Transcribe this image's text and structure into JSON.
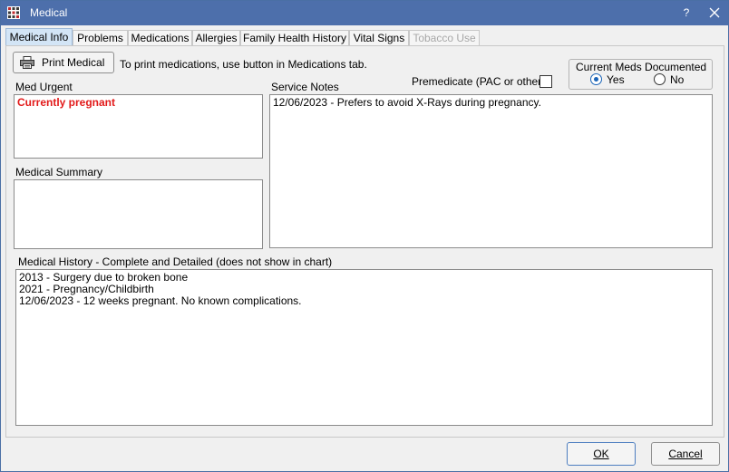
{
  "window": {
    "title": "Medical",
    "help_label": "?"
  },
  "tabs": [
    {
      "label": "Medical Info",
      "active": true,
      "enabled": true
    },
    {
      "label": "Problems",
      "active": false,
      "enabled": true
    },
    {
      "label": "Medications",
      "active": false,
      "enabled": true
    },
    {
      "label": "Allergies",
      "active": false,
      "enabled": true
    },
    {
      "label": "Family Health History",
      "active": false,
      "enabled": true
    },
    {
      "label": "Vital Signs",
      "active": false,
      "enabled": true
    },
    {
      "label": "Tobacco Use",
      "active": false,
      "enabled": false
    }
  ],
  "print": {
    "button_label": "Print Medical",
    "hint": "To print medications, use button in Medications tab."
  },
  "premedicate": {
    "label": "Premedicate (PAC or other)",
    "checked": false
  },
  "current_meds": {
    "title": "Current Meds Documented",
    "options": [
      "Yes",
      "No"
    ],
    "selected": "Yes"
  },
  "med_urgent": {
    "label": "Med Urgent",
    "value": "Currently pregnant"
  },
  "medical_summary": {
    "label": "Medical Summary",
    "value": ""
  },
  "service_notes": {
    "label": "Service Notes",
    "value": "12/06/2023 - Prefers to avoid X-Rays during pregnancy."
  },
  "medical_history": {
    "label": "Medical History - Complete and Detailed (does not show in chart)",
    "lines": [
      "2013 - Surgery due to broken bone",
      "2021 - Pregnancy/Childbirth",
      "12/06/2023 - 12 weeks pregnant. No known complications."
    ]
  },
  "footer": {
    "ok_label": "OK",
    "cancel_label": "Cancel"
  },
  "colors": {
    "titlebar": "#4d6fab",
    "active_tab": "#d3e5f6",
    "urgent_text": "#e21a1a",
    "radio_selected": "#1a64b8"
  }
}
